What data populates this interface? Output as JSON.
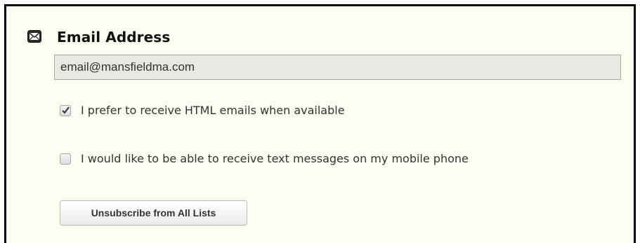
{
  "section": {
    "icon": "envelope-icon",
    "title": "Email Address"
  },
  "email_field": {
    "value": "email@mansfieldma.com"
  },
  "options": [
    {
      "label": "I prefer to receive HTML emails when available",
      "checked": true
    },
    {
      "label": "I would like to be able to receive text messages on my mobile phone",
      "checked": false
    }
  ],
  "unsubscribe_button": {
    "label": "Unsubscribe from All Lists"
  },
  "colors": {
    "panel_background": "#fdfdf2",
    "input_background": "#e9e8e2",
    "border": "#000000"
  }
}
